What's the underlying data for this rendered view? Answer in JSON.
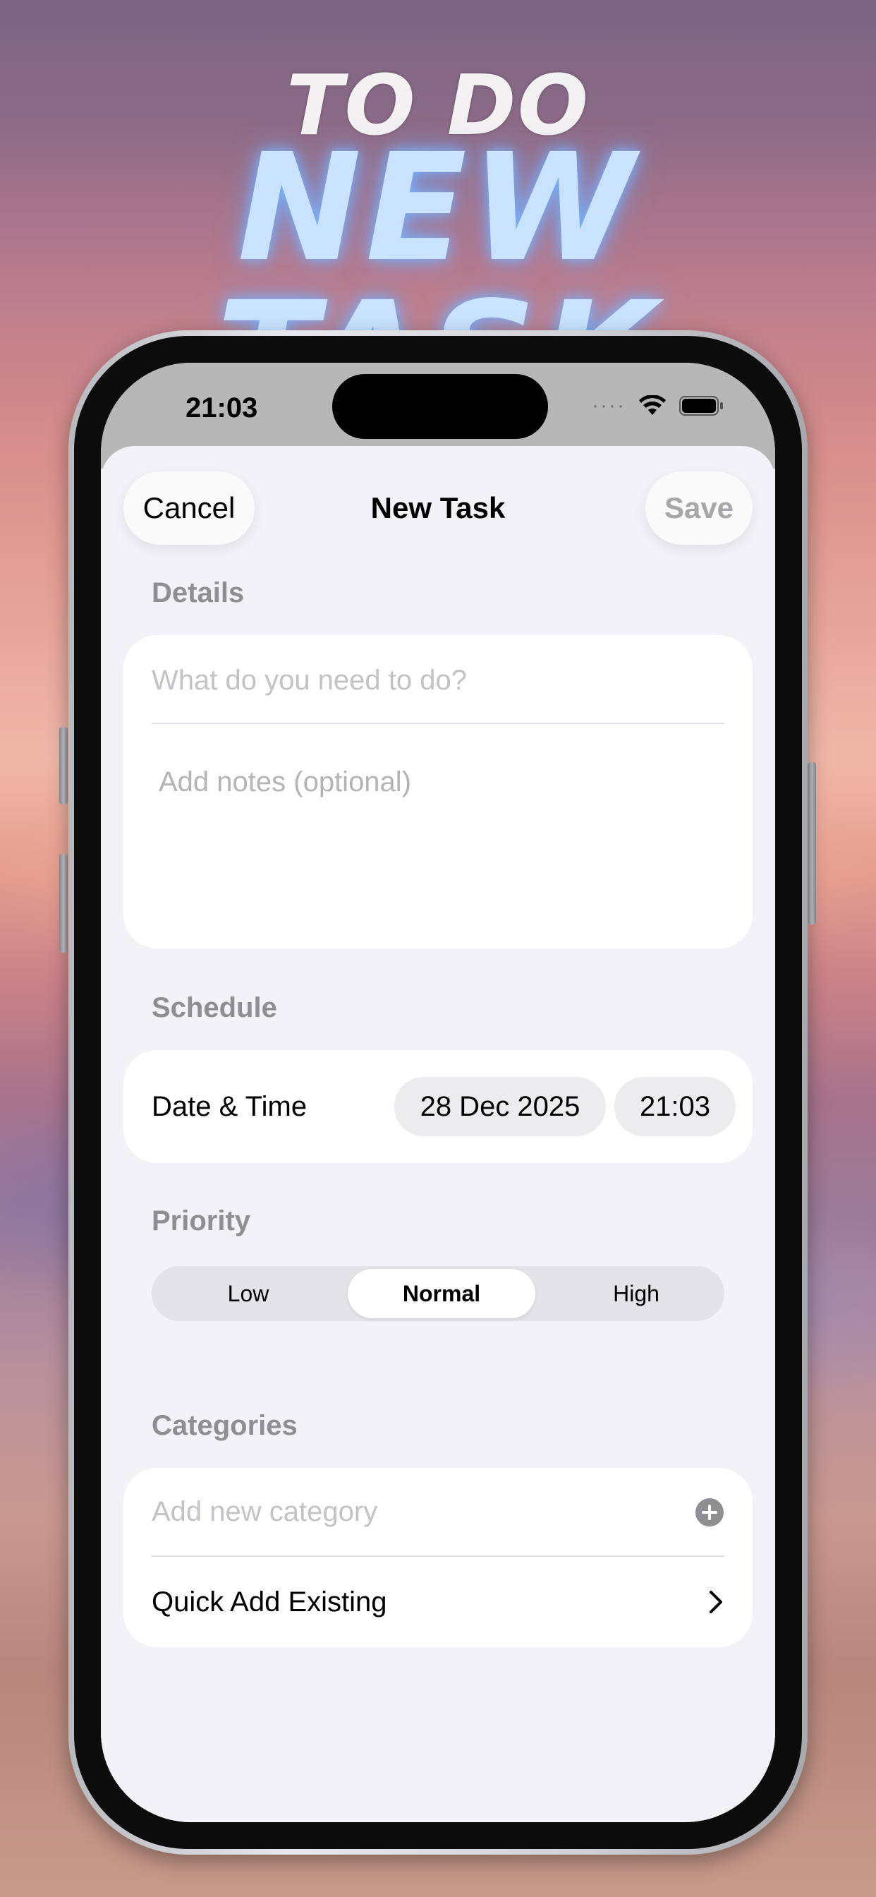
{
  "hero": {
    "top_line": "TO DO",
    "main_line": "NEW TASK"
  },
  "status_bar": {
    "time": "21:03",
    "signal_dots": "····"
  },
  "header": {
    "cancel_label": "Cancel",
    "title": "New Task",
    "save_label": "Save"
  },
  "details": {
    "section_label": "Details",
    "title_placeholder": "What do you need to do?",
    "notes_placeholder": "Add notes (optional)"
  },
  "schedule": {
    "section_label": "Schedule",
    "row_label": "Date & Time",
    "date_value": "28 Dec 2025",
    "time_value": "21:03"
  },
  "priority": {
    "section_label": "Priority",
    "options": [
      "Low",
      "Normal",
      "High"
    ],
    "selected": "Normal"
  },
  "categories": {
    "section_label": "Categories",
    "add_placeholder": "Add new category",
    "quick_add_label": "Quick Add Existing"
  },
  "icons": {
    "add": "plus-circle-icon",
    "chevron": "chevron-right-icon",
    "wifi": "wifi-icon",
    "battery": "battery-icon"
  },
  "colors": {
    "hero_glow": "#c9e3ff",
    "sheet_bg": "#f2f2f7",
    "placeholder": "#c3c3c7",
    "section_label": "#8e8e93"
  }
}
